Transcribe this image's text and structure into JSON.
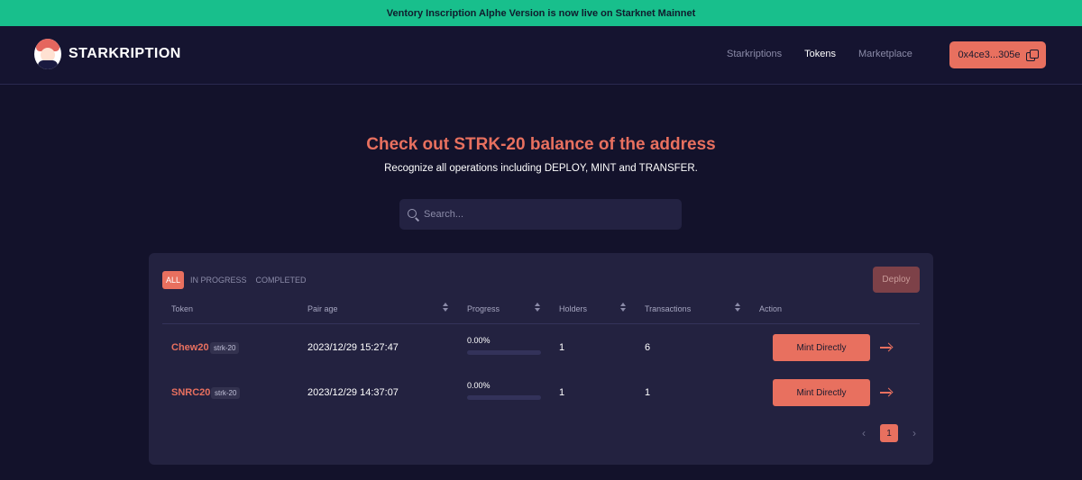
{
  "banner": {
    "text": "Ventory Inscription Alphe Version is now live on Starknet Mainnet"
  },
  "brand": {
    "name": "STARKRIPTION"
  },
  "nav": {
    "links": [
      "Starkriptions",
      "Tokens",
      "Marketplace"
    ],
    "active": "Tokens",
    "wallet_label": "0x4ce3...305e"
  },
  "hero": {
    "title": "Check out STRK-20 balance of the address",
    "subtitle": "Recognize all operations including DEPLOY, MINT and TRANSFER."
  },
  "search": {
    "placeholder": "Search..."
  },
  "filters": {
    "tabs": [
      "ALL",
      "IN PROGRESS",
      "COMPLETED"
    ],
    "active": "ALL"
  },
  "deploy_label": "Deploy",
  "table": {
    "columns": [
      "Token",
      "Pair age",
      "Progress",
      "Holders",
      "Transactions",
      "Action"
    ],
    "rows": [
      {
        "token": "Chew20",
        "badge": "strk-20",
        "pair_age": "2023/12/29 15:27:47",
        "progress": "0.00%",
        "progress_fraction": 0,
        "holders": "1",
        "transactions": "6",
        "action": "Mint Directly"
      },
      {
        "token": "SNRC20",
        "badge": "strk-20",
        "pair_age": "2023/12/29 14:37:07",
        "progress": "0.00%",
        "progress_fraction": 0,
        "holders": "1",
        "transactions": "1",
        "action": "Mint Directly"
      }
    ]
  },
  "pagination": {
    "current": "1",
    "prev": "‹",
    "next": "›"
  },
  "colors": {
    "accent": "#e8705f",
    "banner": "#18bf8c",
    "background": "#13122b",
    "card": "#232240"
  },
  "icons": [
    "logo-icon",
    "copy-icon",
    "search-icon",
    "sort-icon",
    "arrow-right-icon",
    "chevron-left-icon",
    "chevron-right-icon"
  ]
}
